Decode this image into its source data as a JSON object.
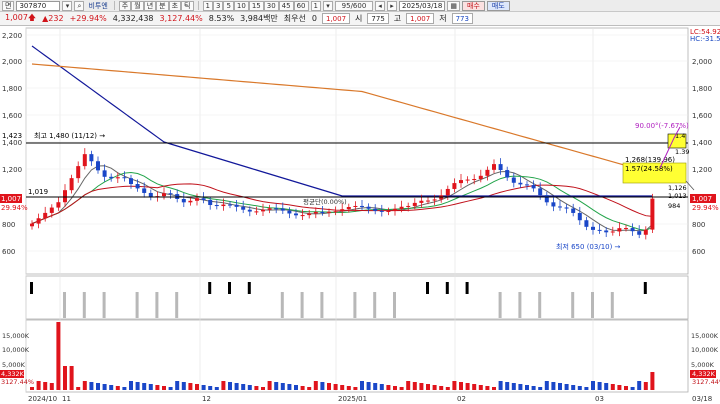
{
  "toolbar": {
    "code": "307870",
    "name": "비투엔",
    "periods": [
      "주",
      "월",
      "년",
      "분",
      "초",
      "틱"
    ],
    "intervals": [
      "1",
      "3",
      "5",
      "10",
      "15",
      "30",
      "45",
      "60"
    ],
    "extra_interval": "1",
    "count": "95/600",
    "date": "2025/03/18",
    "buy_label": "매수",
    "sell_label": "매도",
    "menu_label": "면"
  },
  "quote": {
    "price": "1,007",
    "change": "232",
    "change_pct": "+29.94%",
    "volume": "4,332,438",
    "vol_ratio": "3,127.44%",
    "turnover": "8.53%",
    "amount": "3,984백만",
    "priority_label": "최우선",
    "priority_value": "0",
    "ask_price": "1,007",
    "open_label": "시",
    "open": "775",
    "high_label": "고",
    "high": "1,007",
    "low_label": "저",
    "low": "773"
  },
  "price_axis": {
    "labels": [
      "2,200",
      "2,000",
      "1,800",
      "1,600",
      "1,400",
      "1,200",
      "1,000",
      "800",
      "600"
    ],
    "right_labels": [
      "2,000",
      "1,800",
      "1,600",
      "1,400",
      "1,200",
      "1,000",
      "800",
      "600"
    ],
    "lc_label": "LC:54.92",
    "hc_label": "HC:-31.56",
    "left_price_tag": "1,007",
    "left_pct_tag": "29.94%",
    "right_price_tag": "1,007",
    "right_pct_tag": "29.94%",
    "left_1423": "1,423",
    "left_1019": "1,019"
  },
  "annotations": {
    "high": "최고 1,480 (11/12) →",
    "low": "최저 650 (03/10) →",
    "level1": "1,268(139.96)",
    "level1_pct": "1.57(24.58%)",
    "top": "90.00°(-7.67%)",
    "right_a": "1.4",
    "right_b": "1.39",
    "right_c": "1,126",
    "right_d": "1,013",
    "right_e": "984",
    "mid": "평균단(0.00%)"
  },
  "volume_axis": {
    "labels": [
      "15,000K",
      "10,000K",
      "5,000K"
    ],
    "right_labels": [
      "15,000K",
      "10,000K",
      "5,000K"
    ],
    "left_tag1": "4,332K",
    "left_tag2": "3127.44%",
    "right_tag1": "4,332K",
    "right_tag2": "3127.44%"
  },
  "date_axis": [
    "2024/10",
    "11",
    "12",
    "2025/01",
    "02",
    "03",
    "03/18"
  ],
  "colors": {
    "up": "#e0141c",
    "down": "#1a47c8",
    "ma_blue": "#12189a",
    "ma_orange": "#d9782a",
    "ma_red": "#c0101a",
    "ma_green": "#22a44a",
    "ma_gray": "#666666",
    "highlight": "#ffff33"
  }
}
